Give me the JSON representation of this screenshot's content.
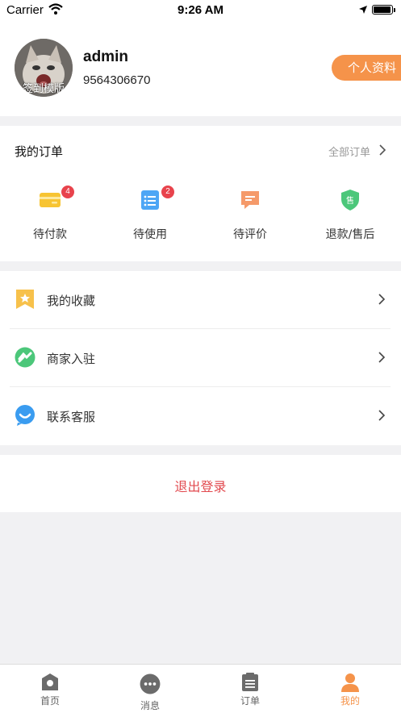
{
  "status_bar": {
    "carrier": "Carrier",
    "time": "9:26 AM"
  },
  "profile": {
    "avatar_label": "签到模版",
    "username": "admin",
    "phone": "9564306670",
    "profile_button": "个人资料"
  },
  "orders": {
    "title": "我的订单",
    "all_link": "全部订单",
    "items": [
      {
        "label": "待付款",
        "badge": "4",
        "icon": "card-icon",
        "color": "#f7c433"
      },
      {
        "label": "待使用",
        "badge": "2",
        "icon": "list-icon",
        "color": "#4da6f5"
      },
      {
        "label": "待评价",
        "badge": "",
        "icon": "comment-icon",
        "color": "#f59a6a"
      },
      {
        "label": "退款/售后",
        "badge": "",
        "icon": "shield-icon",
        "color": "#4cc77a",
        "icon_text": "售"
      }
    ]
  },
  "menu": [
    {
      "label": "我的收藏",
      "icon": "bookmark-star-icon",
      "color": "#f7c14b"
    },
    {
      "label": "商家入驻",
      "icon": "merchant-icon",
      "color": "#4cc77a"
    },
    {
      "label": "联系客服",
      "icon": "customer-service-icon",
      "color": "#3a9cf0"
    }
  ],
  "logout_label": "退出登录",
  "tabbar": [
    {
      "label": "首页",
      "icon": "home-icon",
      "active": false
    },
    {
      "label": "消息",
      "icon": "message-icon",
      "active": false
    },
    {
      "label": "订单",
      "icon": "order-icon",
      "active": false
    },
    {
      "label": "我的",
      "icon": "profile-icon",
      "active": true
    }
  ],
  "colors": {
    "accent": "#f5934a",
    "logout": "#e24a4f",
    "badge": "#e8434c"
  }
}
